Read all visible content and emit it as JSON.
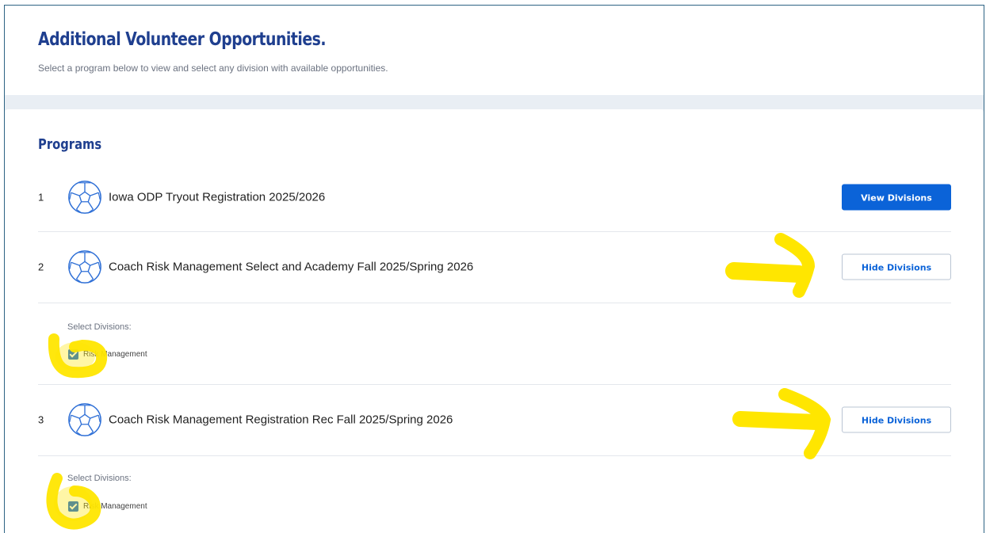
{
  "header": {
    "title": "Additional Volunteer Opportunities.",
    "subtitle": "Select a program below to view and select any division with available opportunities."
  },
  "programs": {
    "title": "Programs",
    "items": [
      {
        "index": "1",
        "name": "Iowa ODP Tryout Registration 2025/2026",
        "button": "View Divisions",
        "icon": "soccer-ball-icon"
      },
      {
        "index": "2",
        "name": "Coach Risk Management Select and Academy Fall 2025/Spring 2026",
        "button": "Hide Divisions",
        "icon": "soccer-ball-icon",
        "divisions": {
          "label": "Select Divisions:",
          "options": [
            {
              "label": "Risk Management",
              "checked": true
            }
          ]
        }
      },
      {
        "index": "3",
        "name": "Coach Risk Management Registration Rec Fall 2025/Spring 2026",
        "button": "Hide Divisions",
        "icon": "soccer-ball-icon",
        "divisions": {
          "label": "Select Divisions:",
          "options": [
            {
              "label": "Risk Management",
              "checked": true
            }
          ]
        }
      }
    ]
  },
  "colors": {
    "title": "#1f3f8f",
    "primary": "#0b63d8",
    "annotation": "#ffe600"
  }
}
